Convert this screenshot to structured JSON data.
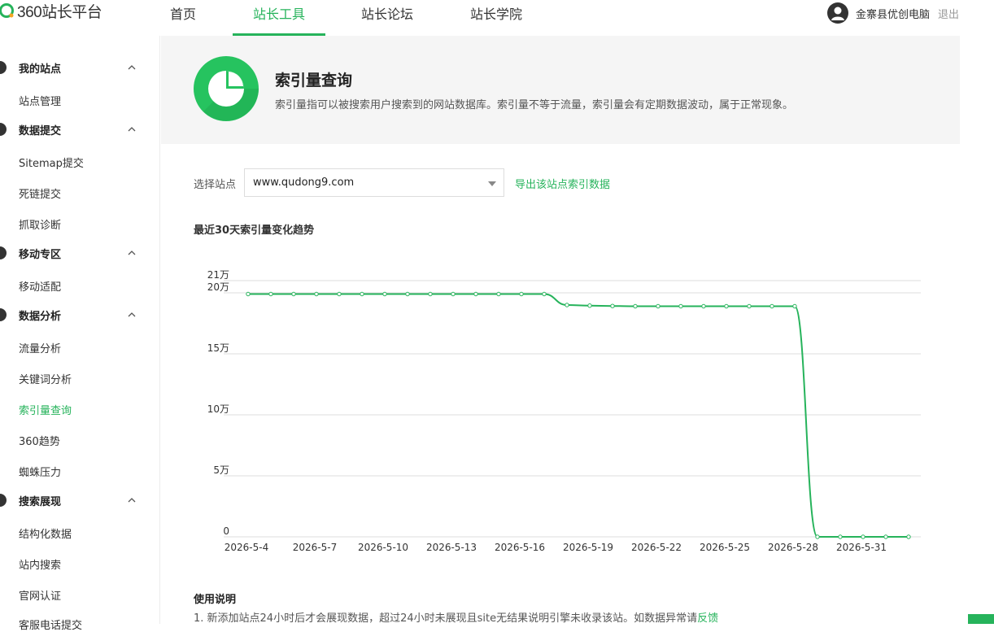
{
  "brand": {
    "logo_text": "360站长平台",
    "accent": "#26b35b"
  },
  "nav": {
    "items": [
      {
        "label": "首页"
      },
      {
        "label": "站长工具"
      },
      {
        "label": "站长论坛"
      },
      {
        "label": "站长学院"
      }
    ],
    "active_index": 1
  },
  "user": {
    "name": "金寨县优创电脑",
    "logout": "退出"
  },
  "sidebar": {
    "groups": [
      {
        "label": "我的站点",
        "items": [
          "站点管理"
        ]
      },
      {
        "label": "数据提交",
        "items": [
          "Sitemap提交",
          "死链提交",
          "抓取诊断"
        ]
      },
      {
        "label": "移动专区",
        "items": [
          "移动适配"
        ]
      },
      {
        "label": "数据分析",
        "items": [
          "流量分析",
          "关键词分析",
          "索引量查询",
          "360趋势",
          "蜘蛛压力"
        ]
      },
      {
        "label": "搜索展现",
        "items": [
          "结构化数据",
          "站内搜索",
          "官网认证",
          "客服电话提交"
        ]
      }
    ],
    "active_item": "索引量查询"
  },
  "banner": {
    "title": "索引量查询",
    "description": "索引量指可以被搜索用户搜索到的网站数据库。索引量不等于流量，索引量会有定期数据波动，属于正常现象。"
  },
  "site_selector": {
    "label": "选择站点",
    "value": "www.qudong9.com",
    "export_link": "导出该站点索引数据"
  },
  "chart_heading": "最近30天索引量变化趋势",
  "chart_data": {
    "type": "line",
    "x": [
      "2026-5-4",
      "2026-5-5",
      "2026-5-6",
      "2026-5-7",
      "2026-5-8",
      "2026-5-9",
      "2026-5-10",
      "2026-5-11",
      "2026-5-12",
      "2026-5-13",
      "2026-5-14",
      "2026-5-15",
      "2026-5-16",
      "2026-5-17",
      "2026-5-18",
      "2026-5-19",
      "2026-5-20",
      "2026-5-21",
      "2026-5-22",
      "2026-5-23",
      "2026-5-24",
      "2026-5-25",
      "2026-5-26",
      "2026-5-27",
      "2026-5-28",
      "2026-5-29",
      "2026-5-30",
      "2026-5-31",
      "2026-6-1",
      "2026-6-2"
    ],
    "xtick_labels": [
      "2026-5-4",
      "2026-5-7",
      "2026-5-10",
      "2026-5-13",
      "2026-5-16",
      "2026-5-19",
      "2026-5-22",
      "2026-5-25",
      "2026-5-28",
      "2026-5-31"
    ],
    "xtick_every": 3,
    "values": [
      199000,
      199000,
      199000,
      199000,
      199000,
      199000,
      199000,
      199000,
      199000,
      199000,
      199000,
      199000,
      199000,
      199000,
      190000,
      189500,
      189200,
      189000,
      189000,
      189000,
      189000,
      189000,
      189000,
      189000,
      189000,
      0,
      0,
      0,
      0,
      0
    ],
    "ytick_values": [
      0,
      50000,
      100000,
      150000,
      200000,
      210000
    ],
    "ytick_labels": [
      "0",
      "5万",
      "10万",
      "15万",
      "20万",
      "21万"
    ],
    "ylim": [
      0,
      210000
    ],
    "grid": true,
    "line_color": "#26b35b"
  },
  "usage": {
    "title": "使用说明",
    "line1": "1. 新添加站点24小时后才会展现数据，超过24小时未展现且site无结果说明引擎未收录该站。如数据异常请",
    "line1_link": "反馈"
  }
}
